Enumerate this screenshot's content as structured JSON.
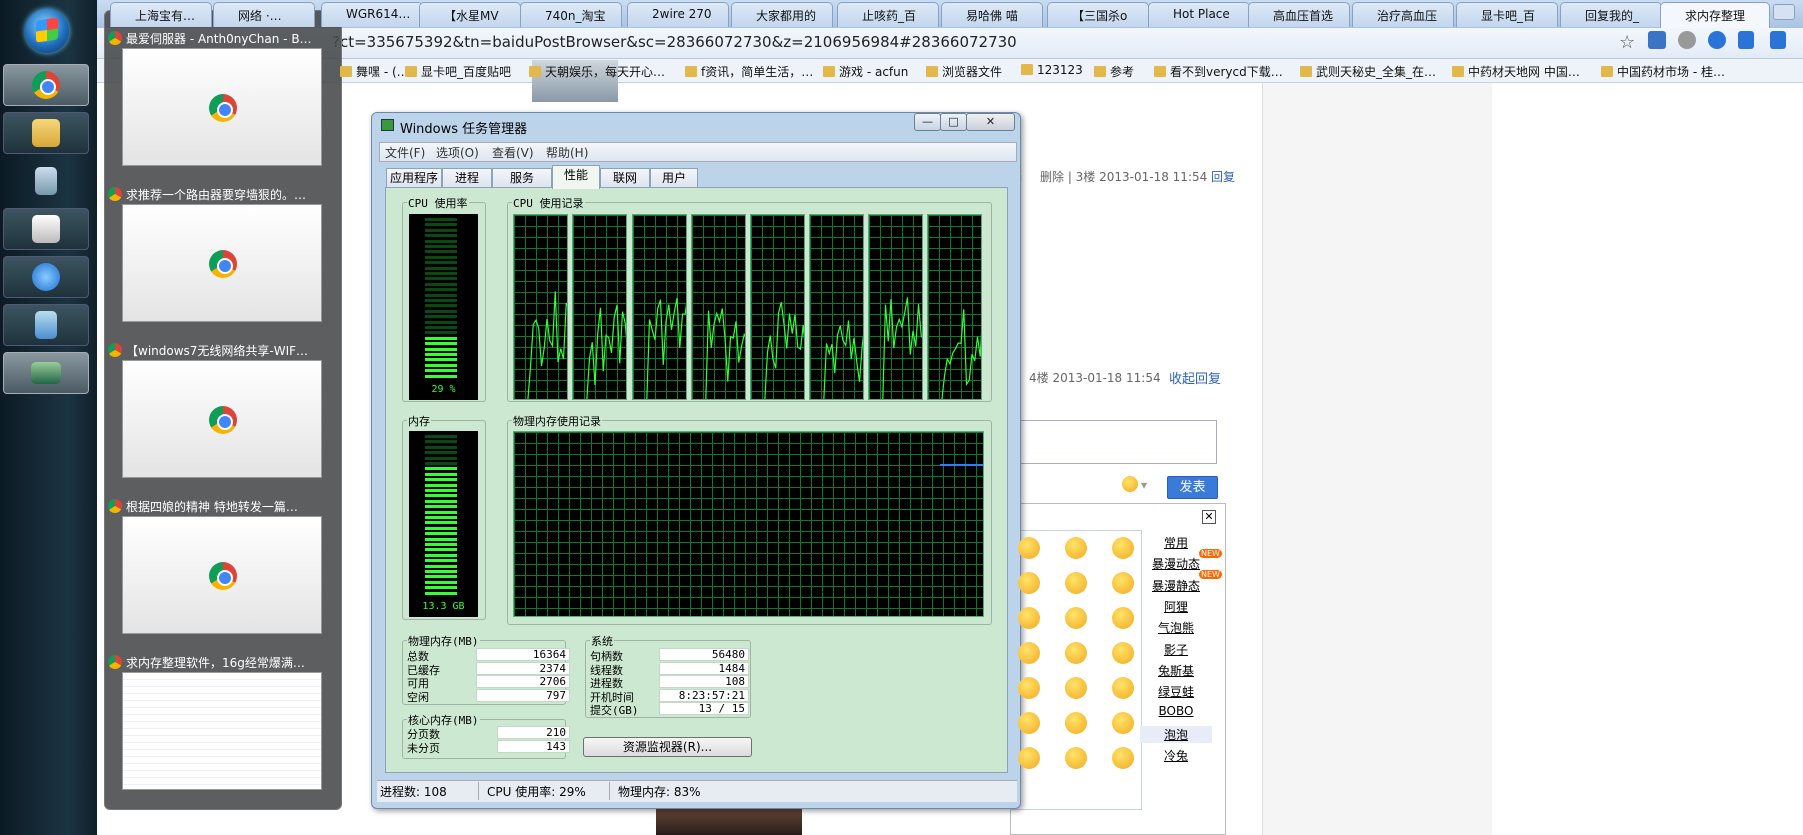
{
  "taskbar": {
    "buttons": [
      "chrome",
      "explorer",
      "calculator",
      "printer",
      "ie",
      "notepad",
      "task-manager"
    ]
  },
  "browser": {
    "tabs": [
      "上海宝有…",
      "网络 ·…",
      "WGR614…",
      "【水星MV",
      "740n_淘宝",
      "2wire 270",
      "大家都用的",
      "止咳药_百",
      "易哈佛 喵",
      "【三国杀o",
      "Hot Place",
      "高血压首选",
      "治疗高血压",
      "显卡吧_百",
      "回复我的_",
      "求内存整理"
    ],
    "url": "?ct=335675392&tn=baiduPostBrowser&sc=28366072730&z=2106956984#28366072730",
    "bookmarks": [
      "舞嘿 - (…",
      "显卡吧_百度贴吧",
      "天朝娱乐，每天开心…",
      "f资讯，简单生活，…",
      "游戏 - acfun",
      "浏览器文件",
      "123123",
      "参考",
      "看不到verycd下载…",
      "武则天秘史_全集_在…",
      "中药材天地网 中国…",
      "中国药材市场 - 桂…"
    ]
  },
  "page": {
    "post3": {
      "actions": "删除 | 3楼 2013-01-18 11:54",
      "reply": "回复"
    },
    "post4": {
      "meta": "4楼 2013-01-18 11:54",
      "collapse": "收起回复"
    },
    "send_label": "发表",
    "emoji_close": "✕",
    "emoji_categories": [
      "常用",
      "暴漫动态",
      "暴漫静态",
      "阿狸",
      "气泡熊",
      "影子",
      "兔斯基",
      "绿豆蛙",
      "BOBO",
      "泡泡",
      "冷兔"
    ],
    "new_badge": "NEW"
  },
  "thumbnails": [
    {
      "title": "最爱伺服器 - Anth0nyChan - B…"
    },
    {
      "title": "求推荐一个路由器要穿墙狠的。…"
    },
    {
      "title": "【windows7无线网络共享-WIF…"
    },
    {
      "title": "根据四娘的精神 特地转发一篇…"
    },
    {
      "title": "求内存整理软件，16g经常爆满…"
    }
  ],
  "taskmgr": {
    "title": "Windows 任务管理器",
    "menus": [
      "文件(F)",
      "选项(O)",
      "查看(V)",
      "帮助(H)"
    ],
    "tabs": [
      "应用程序",
      "进程",
      "服务",
      "性能",
      "联网",
      "用户"
    ],
    "active_tab": "性能",
    "cpu_usage_label": "CPU 使用率",
    "cpu_usage_value": "29 %",
    "cpu_usage_fraction": 0.29,
    "cpu_history_label": "CPU 使用记录",
    "memory_label": "内存",
    "memory_value": "13.3 GB",
    "memory_fraction": 0.83,
    "mem_history_label": "物理内存使用记录",
    "physical": {
      "label": "物理内存(MB)",
      "rows": [
        {
          "k": "总数",
          "v": "16364"
        },
        {
          "k": "已缓存",
          "v": "2374"
        },
        {
          "k": "可用",
          "v": "2706"
        },
        {
          "k": "空闲",
          "v": "797"
        }
      ]
    },
    "kernel": {
      "label": "核心内存(MB)",
      "rows": [
        {
          "k": "分页数",
          "v": "210"
        },
        {
          "k": "未分页",
          "v": "143"
        }
      ]
    },
    "system": {
      "label": "系统",
      "rows": [
        {
          "k": "句柄数",
          "v": "56480"
        },
        {
          "k": "线程数",
          "v": "1484"
        },
        {
          "k": "进程数",
          "v": "108"
        },
        {
          "k": "开机时间",
          "v": "8:23:57:21"
        },
        {
          "k": "提交(GB)",
          "v": "13 / 15"
        }
      ]
    },
    "resource_monitor": "资源监视器(R)...",
    "status": {
      "processes": "进程数: 108",
      "cpu": "CPU 使用率: 29%",
      "memory": "物理内存: 83%"
    }
  }
}
